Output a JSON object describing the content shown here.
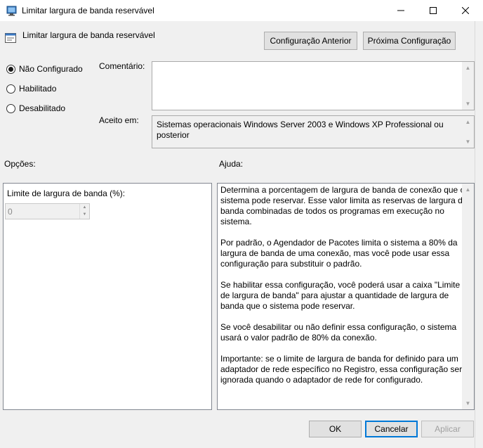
{
  "window": {
    "title": "Limitar largura de banda reservável",
    "icon": "policy-settings-icon"
  },
  "header": {
    "title": "Limitar largura de banda reservável",
    "prev_label": "Configuração Anterior",
    "next_label": "Próxima Configuração"
  },
  "state": {
    "options": [
      {
        "label": "Não Configurado",
        "checked": true
      },
      {
        "label": "Habilitado",
        "checked": false
      },
      {
        "label": "Desabilitado",
        "checked": false
      }
    ]
  },
  "comment": {
    "label": "Comentário:",
    "value": ""
  },
  "supported": {
    "label": "Aceito em:",
    "value": "Sistemas operacionais Windows Server 2003 e Windows XP Professional ou posterior"
  },
  "options_panel": {
    "label": "Opções:",
    "field_label": "Limite de largura de banda (%):",
    "field_value": "0"
  },
  "help_panel": {
    "label": "Ajuda:",
    "paragraphs": [
      "Determina a porcentagem de largura de banda de conexão que o sistema pode reservar. Esse valor limita as reservas de largura de banda combinadas de todos os programas em execução no sistema.",
      "Por padrão, o Agendador de Pacotes limita o sistema a 80% da largura de banda de uma conexão, mas você pode usar essa configuração para substituir o padrão.",
      "Se habilitar essa configuração, você poderá usar a caixa \"Limite de largura de banda\" para ajustar a quantidade de largura de banda que o sistema pode reservar.",
      "Se você desabilitar ou não definir essa configuração, o sistema usará o valor padrão de 80% da conexão.",
      "Importante: se o limite de largura de banda for definido para um adaptador de rede específico no Registro, essa configuração será ignorada quando o adaptador de rede for configurado."
    ]
  },
  "footer": {
    "ok_label": "OK",
    "cancel_label": "Cancelar",
    "apply_label": "Aplicar"
  },
  "colors": {
    "accent": "#0078d7",
    "background": "#f0f0f0"
  }
}
